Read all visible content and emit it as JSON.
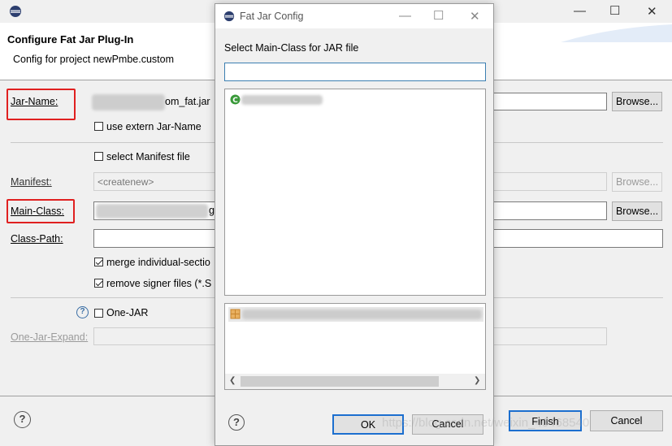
{
  "main": {
    "title": "Configure Fat Jar Plug-In",
    "subtitle": "Config for project newPmbe.custom",
    "jar_name_label": "Jar-Name:",
    "jar_name_value": "om_fat.jar",
    "browse_label": "Browse...",
    "use_extern_label": "use extern Jar-Name",
    "select_manifest_label": "select Manifest file",
    "manifest_label": "Manifest:",
    "manifest_value": "<createnew>",
    "main_class_label": "Main-Class:",
    "main_class_value": "g",
    "class_path_label": "Class-Path:",
    "merge_label": "merge individual-sectio",
    "remove_signer_label": "remove signer files (*.S",
    "one_jar_label": "One-JAR",
    "one_jar_expand_label": "One-Jar-Expand:",
    "help_glyph": "?",
    "finish_label": "Finish",
    "cancel_label": "Cancel",
    "merge_checked": true,
    "remove_signer_checked": true
  },
  "dialog": {
    "title": "Fat Jar Config",
    "prompt": "Select Main-Class for JAR file",
    "filter_value": "",
    "ok_label": "OK",
    "cancel_label": "Cancel",
    "help_glyph": "?"
  },
  "window_controls": {
    "minimize": "—",
    "maximize": "☐",
    "close": "✕"
  },
  "watermark": "https://blog.csdn.net/weixin_40468540",
  "colors": {
    "highlight_red": "#e02020",
    "eclipse_blue": "#2c3e6e",
    "class_icon_green": "#3a9a3a",
    "package_icon_orange": "#c8842c"
  }
}
